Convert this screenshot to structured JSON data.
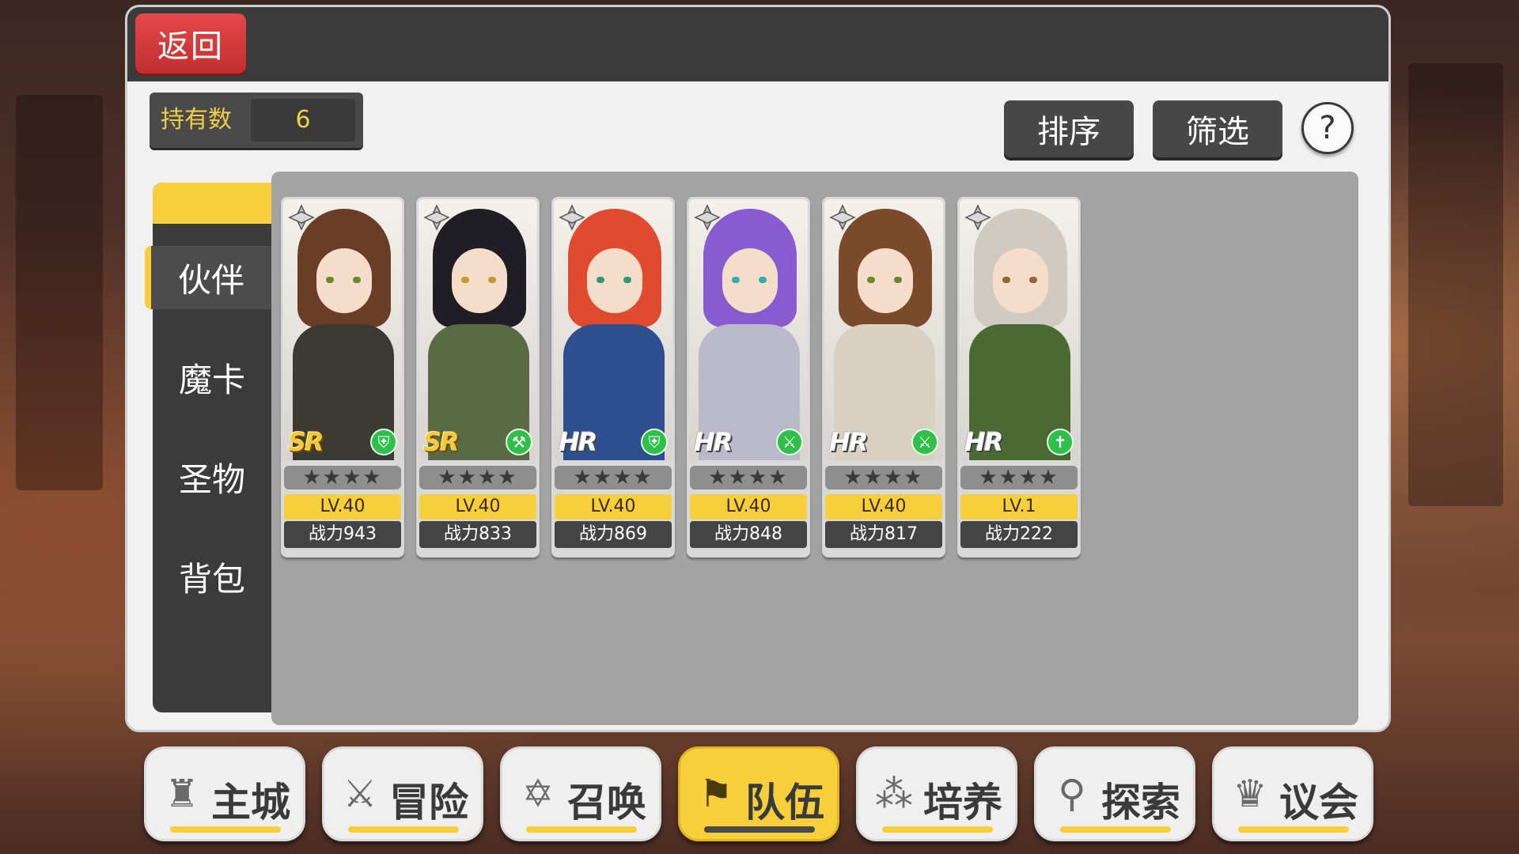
{
  "header": {
    "back_label": "返回"
  },
  "holding": {
    "label": "持有数",
    "count": "6"
  },
  "toolbar": {
    "sort_label": "排序",
    "filter_label": "筛选",
    "help_label": "?"
  },
  "tabs": [
    {
      "label": "伙伴",
      "active": true
    },
    {
      "label": "魔卡",
      "active": false
    },
    {
      "label": "圣物",
      "active": false
    },
    {
      "label": "背包",
      "active": false
    }
  ],
  "cards": [
    {
      "rarity": "SR",
      "stars": "★★★★",
      "level": "LV.40",
      "power": "战力943",
      "class_icon": "shield-class-icon",
      "hair": "#6a3d26",
      "outfit": "#3b3a34",
      "eye": "#6a8a2a"
    },
    {
      "rarity": "SR",
      "stars": "★★★★",
      "level": "LV.40",
      "power": "战力833",
      "class_icon": "axe-class-icon",
      "hair": "#1e1e24",
      "outfit": "#5a6a44",
      "eye": "#c49a2a"
    },
    {
      "rarity": "HR",
      "stars": "★★★★",
      "level": "LV.40",
      "power": "战力869",
      "class_icon": "shield-class-icon",
      "hair": "#e04a2e",
      "outfit": "#2d4f8e",
      "eye": "#2a9a7a"
    },
    {
      "rarity": "HR",
      "stars": "★★★★",
      "level": "LV.40",
      "power": "战力848",
      "class_icon": "sword-class-icon",
      "hair": "#8a5ad0",
      "outfit": "#b9b9c9",
      "eye": "#2ab0b0"
    },
    {
      "rarity": "HR",
      "stars": "★★★★",
      "level": "LV.40",
      "power": "战力817",
      "class_icon": "sword-class-icon",
      "hair": "#7a4a2a",
      "outfit": "#d8d0c0",
      "eye": "#6a8a2a"
    },
    {
      "rarity": "HR",
      "stars": "★★★★",
      "level": "LV.1",
      "power": "战力222",
      "class_icon": "cross-class-icon",
      "hair": "#cfcac2",
      "outfit": "#4a6a34",
      "eye": "#8a6a3a"
    }
  ],
  "nav": [
    {
      "label": "主城",
      "icon": "castle-icon",
      "active": false
    },
    {
      "label": "冒险",
      "icon": "crossed-swords-icon",
      "active": false
    },
    {
      "label": "召唤",
      "icon": "summon-circle-icon",
      "active": false
    },
    {
      "label": "队伍",
      "icon": "team-banner-icon",
      "active": true
    },
    {
      "label": "培养",
      "icon": "train-icon",
      "active": false
    },
    {
      "label": "探索",
      "icon": "explore-icon",
      "active": false
    },
    {
      "label": "议会",
      "icon": "council-icon",
      "active": false
    }
  ],
  "colors": {
    "accent": "#f7cf3c",
    "back_button": "#d63a3a",
    "panel_dark": "#3b3b3b",
    "class_green": "#2fbf4a"
  }
}
